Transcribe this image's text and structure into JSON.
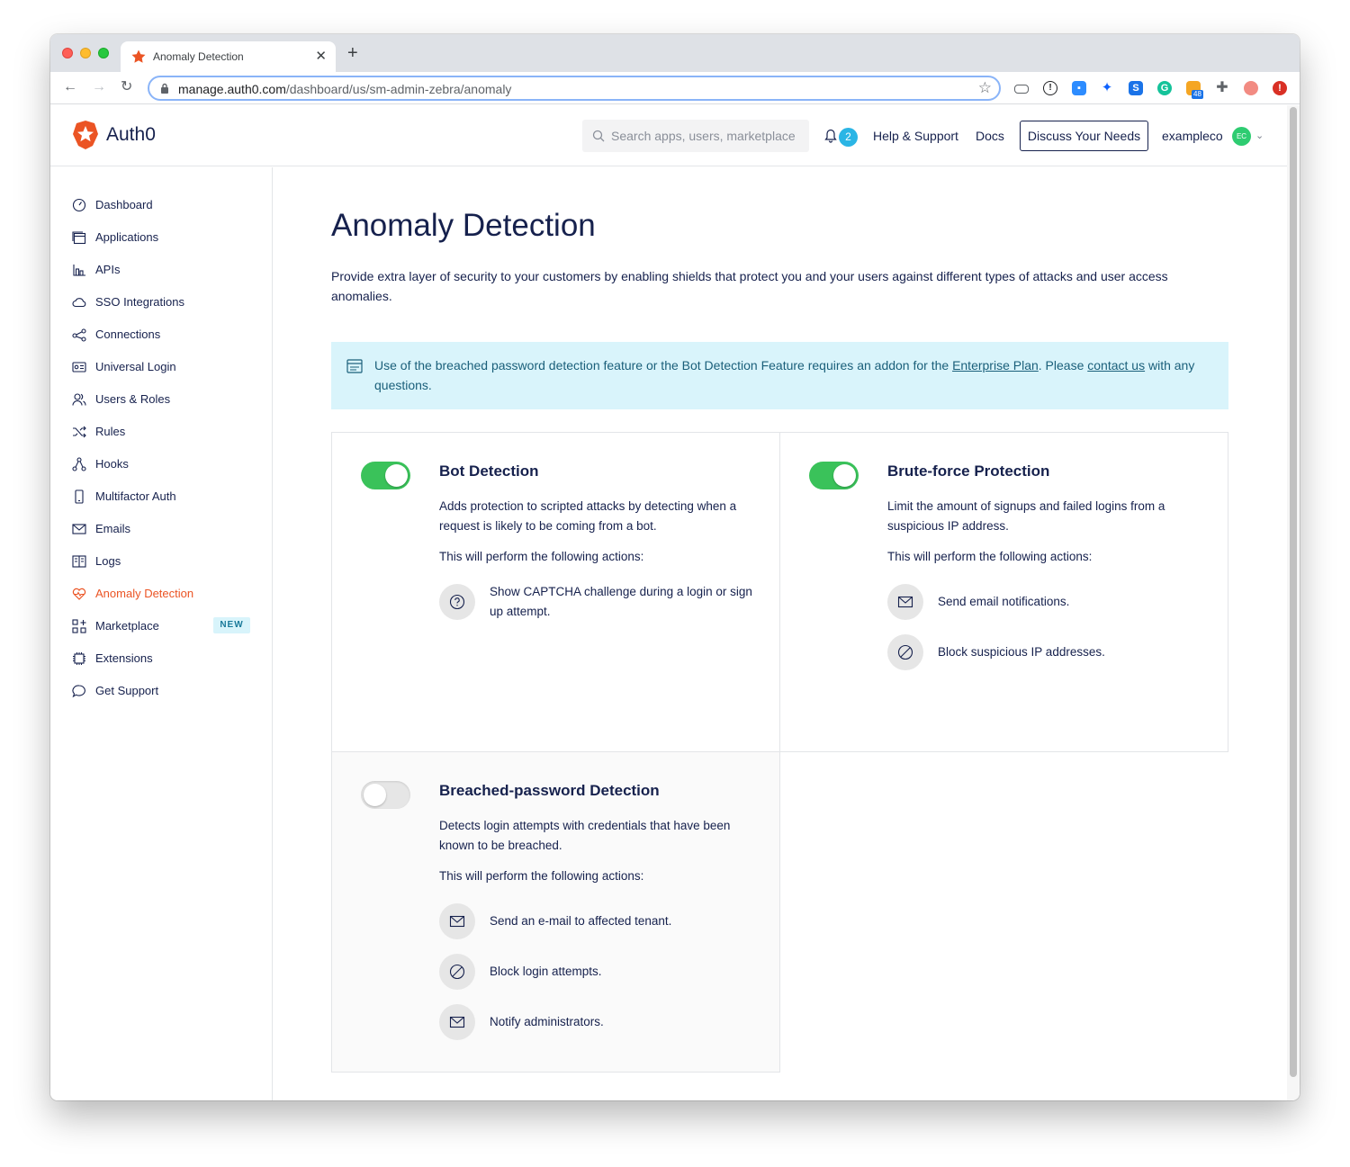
{
  "browser": {
    "tab_title": "Anomaly Detection",
    "url_host": "manage.auth0.com",
    "url_path": "/dashboard/us/sm-admin-zebra/anomaly",
    "extension_badge": "48"
  },
  "header": {
    "logo_text": "Auth0",
    "search_placeholder": "Search apps, users, marketplace",
    "notifications_count": "2",
    "help_label": "Help & Support",
    "docs_label": "Docs",
    "discuss_label": "Discuss Your Needs",
    "tenant_name": "exampleco",
    "avatar_initials": "EC"
  },
  "sidebar": {
    "items": [
      {
        "label": "Dashboard",
        "icon": "gauge-icon"
      },
      {
        "label": "Applications",
        "icon": "window-stack-icon"
      },
      {
        "label": "APIs",
        "icon": "api-icon"
      },
      {
        "label": "SSO Integrations",
        "icon": "cloud-icon"
      },
      {
        "label": "Connections",
        "icon": "share-nodes-icon"
      },
      {
        "label": "Universal Login",
        "icon": "id-card-icon"
      },
      {
        "label": "Users & Roles",
        "icon": "users-icon"
      },
      {
        "label": "Rules",
        "icon": "shuffle-icon"
      },
      {
        "label": "Hooks",
        "icon": "hooks-icon"
      },
      {
        "label": "Multifactor Auth",
        "icon": "phone-icon"
      },
      {
        "label": "Emails",
        "icon": "envelope-icon"
      },
      {
        "label": "Logs",
        "icon": "book-icon"
      },
      {
        "label": "Anomaly Detection",
        "icon": "heart-icon"
      },
      {
        "label": "Marketplace",
        "icon": "grid-plus-icon",
        "badge": "NEW"
      },
      {
        "label": "Extensions",
        "icon": "chip-icon"
      },
      {
        "label": "Get Support",
        "icon": "chat-bubble-icon"
      }
    ],
    "active_index": 12,
    "accent_color": "#eb5424"
  },
  "main": {
    "title": "Anomaly Detection",
    "description": "Provide extra layer of security to your customers by enabling shields that protect you and your users against different types of attacks and user access anomalies.",
    "alert": {
      "text_before": "Use of the breached password detection feature or the Bot Detection Feature requires an addon for the ",
      "link1": "Enterprise Plan",
      "text_middle": ". Please ",
      "link2": "contact us",
      "text_after": " with any questions."
    },
    "cards": [
      {
        "title": "Bot Detection",
        "enabled": true,
        "description": "Adds protection to scripted attacks by detecting when a request is likely to be coming from a bot.",
        "actions_title": "This will perform the following actions:",
        "actions": [
          {
            "icon": "question-icon",
            "text": "Show CAPTCHA challenge during a login or sign up attempt."
          }
        ]
      },
      {
        "title": "Brute-force Protection",
        "enabled": true,
        "description": "Limit the amount of signups and failed logins from a suspicious IP address.",
        "actions_title": "This will perform the following actions:",
        "actions": [
          {
            "icon": "envelope-icon",
            "text": "Send email notifications."
          },
          {
            "icon": "block-icon",
            "text": "Block suspicious IP addresses."
          }
        ]
      },
      {
        "title": "Breached-password Detection",
        "enabled": false,
        "description": "Detects login attempts with credentials that have been known to be breached.",
        "actions_title": "This will perform the following actions:",
        "actions": [
          {
            "icon": "envelope-icon",
            "text": "Send an e-mail to affected tenant."
          },
          {
            "icon": "block-icon",
            "text": "Block login attempts."
          },
          {
            "icon": "envelope-icon",
            "text": "Notify administrators."
          }
        ]
      }
    ],
    "toggle_on_color": "#3ac25a",
    "alert_bg_color": "#d9f4fb"
  }
}
